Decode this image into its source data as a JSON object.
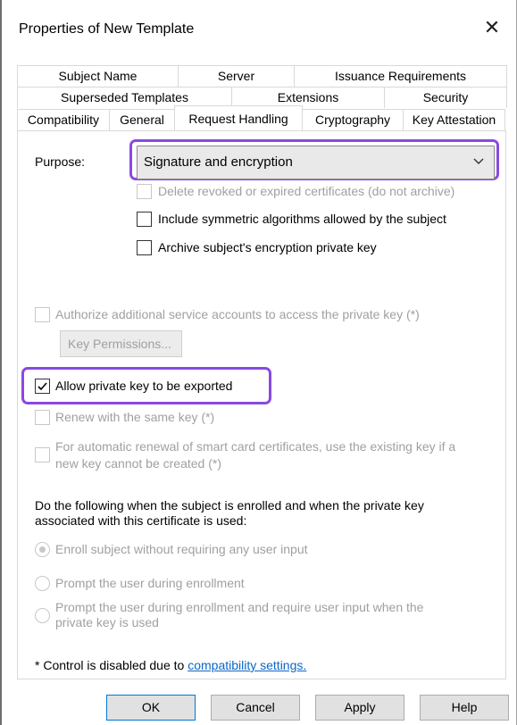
{
  "window": {
    "title": "Properties of New Template"
  },
  "tabs": {
    "row1": [
      "Subject Name",
      "Server",
      "Issuance Requirements"
    ],
    "row2": [
      "Superseded Templates",
      "Extensions",
      "Security"
    ],
    "row3": [
      "Compatibility",
      "General",
      "Request Handling",
      "Cryptography",
      "Key Attestation"
    ]
  },
  "purpose": {
    "label": "Purpose:",
    "selected": "Signature and encryption"
  },
  "options": {
    "delete_revoked": "Delete revoked or expired certificates (do not archive)",
    "include_symmetric": "Include symmetric algorithms allowed by the subject",
    "archive_key": "Archive subject's encryption private key",
    "authorize_accounts": "Authorize additional service accounts to access the private key (*)",
    "key_permissions": "Key Permissions...",
    "allow_export": "Allow private key to be exported",
    "renew_same_key": "Renew with the same key (*)",
    "smart_card_line1": "For automatic renewal of smart card certificates, use the existing key if a",
    "smart_card_line2": "new key cannot be created (*)"
  },
  "enroll": {
    "instruction_line1": "Do the following when the subject is enrolled and when the private key",
    "instruction_line2": "associated with this certificate is used:",
    "radio1": "Enroll subject without requiring any user input",
    "radio2": "Prompt the user during enrollment",
    "radio3_line1": "Prompt the user during enrollment and require user input when the",
    "radio3_line2": "private key is used"
  },
  "footnote": {
    "text": "* Control is disabled due to ",
    "link": "compatibility settings."
  },
  "buttons": {
    "ok": "OK",
    "cancel": "Cancel",
    "apply": "Apply",
    "help": "Help"
  },
  "colors": {
    "highlight": "#8a49e0",
    "link": "#0a66c8",
    "disabled": "#a0a0a0"
  },
  "state": {
    "allow_export_checked": true,
    "selected_radio": 1
  }
}
